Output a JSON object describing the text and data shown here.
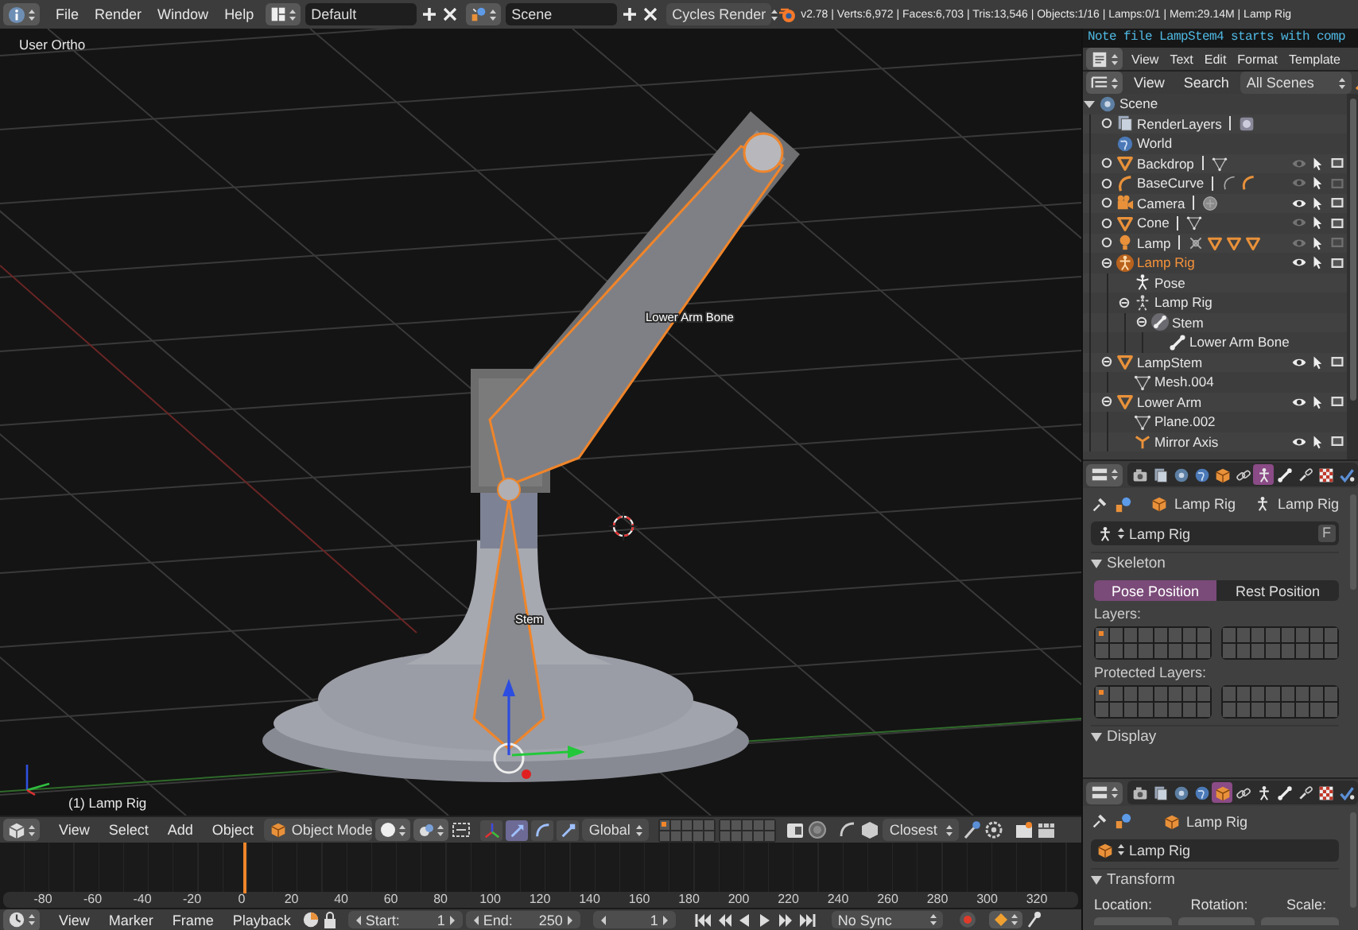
{
  "info_header": {
    "menus": [
      "File",
      "Render",
      "Window",
      "Help"
    ],
    "layout": "Default",
    "scene": "Scene",
    "render_engine": "Cycles Render",
    "stats": "v2.78 | Verts:6,972 | Faces:6,703 | Tris:13,546 | Objects:1/16 | Lamps:0/1 | Mem:29.14M | Lamp Rig"
  },
  "viewport": {
    "view_name": "User Ortho",
    "bone_labels": [
      "Lower Arm Bone",
      "Stem"
    ],
    "object_info": "(1) Lamp Rig"
  },
  "view3d_header": {
    "menus": [
      "View",
      "Select",
      "Add",
      "Object"
    ],
    "mode": "Object Mode",
    "manipulators": [
      {
        "kind": "axes",
        "selected": false
      },
      {
        "kind": "translate",
        "selected": true
      },
      {
        "kind": "rotate",
        "selected": false
      },
      {
        "kind": "scale",
        "selected": false
      }
    ],
    "orientation": "Global",
    "scene_layers": [
      true,
      false,
      false,
      false,
      false,
      false,
      false,
      false,
      false,
      false,
      false,
      false,
      false,
      false,
      false,
      false,
      false,
      false,
      false,
      false
    ],
    "snap_element": "Closest"
  },
  "timeline": {
    "ruler": [
      "-80",
      "-60",
      "-40",
      "-20",
      "0",
      "20",
      "40",
      "60",
      "80",
      "100",
      "120",
      "140",
      "160",
      "180",
      "200",
      "220",
      "240",
      "260",
      "280",
      "300",
      "320"
    ]
  },
  "timeline_header": {
    "menus": [
      "View",
      "Marker",
      "Frame",
      "Playback"
    ],
    "start_label": "Start:",
    "start": "1",
    "end_label": "End:",
    "end": "250",
    "current": "1",
    "sync": "No Sync"
  },
  "text_editor": {
    "line": "Note file LampStem4 starts with comp",
    "menus": [
      "View",
      "Text",
      "Edit",
      "Format",
      "Template"
    ]
  },
  "outliner": {
    "menus": [
      "View",
      "Search"
    ],
    "display_mode": "All Scenes",
    "tree": [
      {
        "label": "Scene",
        "kind": "scene",
        "selected": false,
        "expanded": true,
        "children": [
          {
            "label": "RenderLayers",
            "kind": "render_layers",
            "selected": false,
            "expanded": false,
            "extras": [
              {
                "kind": "render_layer"
              }
            ]
          },
          {
            "label": "World",
            "kind": "world",
            "selected": false
          },
          {
            "label": "Backdrop",
            "kind": "mesh_object",
            "selected": false,
            "expanded": false,
            "visible": false,
            "renderable": true,
            "extras": [
              {
                "kind": "mesh_data"
              }
            ]
          },
          {
            "label": "BaseCurve",
            "kind": "curve_object",
            "selected": false,
            "expanded": false,
            "visible": false,
            "renderable": false,
            "extras": [
              {
                "kind": "curve_data"
              },
              {
                "kind": "curve_object"
              }
            ]
          },
          {
            "label": "Camera",
            "kind": "camera_object",
            "selected": false,
            "expanded": false,
            "visible": true,
            "renderable": true,
            "extras": [
              {
                "kind": "camera_data"
              }
            ]
          },
          {
            "label": "Cone",
            "kind": "mesh_object",
            "selected": false,
            "expanded": false,
            "visible": false,
            "renderable": true,
            "extras": [
              {
                "kind": "mesh_data"
              }
            ]
          },
          {
            "label": "Lamp",
            "kind": "lamp_object",
            "selected": false,
            "expanded": false,
            "visible": false,
            "renderable": false,
            "extras": [
              {
                "kind": "lamp_data"
              },
              {
                "kind": "mesh_object"
              },
              {
                "kind": "mesh_object"
              },
              {
                "kind": "mesh_object"
              }
            ]
          },
          {
            "label": "Lamp Rig",
            "kind": "armature_object",
            "selected": true,
            "expanded": true,
            "visible": true,
            "renderable": true,
            "children": [
              {
                "label": "Pose",
                "kind": "pose",
                "selected": false
              },
              {
                "label": "Lamp Rig",
                "kind": "armature_data",
                "selected": false,
                "expanded": true,
                "children": [
                  {
                    "label": "Stem",
                    "kind": "active_bone",
                    "selected": false,
                    "expanded": true,
                    "children": [
                      {
                        "label": "Lower Arm Bone",
                        "kind": "bone",
                        "selected": false
                      }
                    ]
                  }
                ]
              }
            ]
          },
          {
            "label": "LampStem",
            "kind": "mesh_object",
            "selected": false,
            "expanded": true,
            "visible": true,
            "renderable": true,
            "children": [
              {
                "label": "Mesh.004",
                "kind": "mesh_data",
                "selected": false
              }
            ]
          },
          {
            "label": "Lower Arm",
            "kind": "mesh_object",
            "selected": false,
            "expanded": true,
            "visible": true,
            "renderable": true,
            "children": [
              {
                "label": "Plane.002",
                "kind": "mesh_data",
                "selected": false
              },
              {
                "label": "Mirror Axis",
                "kind": "empty_object",
                "selected": false,
                "visible": true,
                "renderable": true
              }
            ]
          }
        ]
      }
    ]
  },
  "properties": [
    {
      "tabs": [
        {
          "kind": "render",
          "selected": false
        },
        {
          "kind": "render_layers",
          "selected": false
        },
        {
          "kind": "scene",
          "selected": false
        },
        {
          "kind": "world",
          "selected": false
        },
        {
          "kind": "object",
          "selected": false
        },
        {
          "kind": "constraints",
          "selected": false
        },
        {
          "kind": "armature",
          "selected": true
        },
        {
          "kind": "bone",
          "selected": false
        },
        {
          "kind": "bone_constraints",
          "selected": false
        },
        {
          "kind": "texture",
          "selected": false
        },
        {
          "kind": "physics",
          "selected": false
        }
      ],
      "breadcrumb": [
        {
          "kind": "object",
          "label": "Lamp Rig"
        },
        {
          "kind": "armature",
          "label": "Lamp Rig"
        }
      ],
      "datablock": {
        "kind": "armature",
        "name": "Lamp Rig",
        "fake_user": "F"
      },
      "panels": [
        {
          "kind": "skeleton",
          "title": "Skeleton",
          "expanded": true,
          "positions": [
            {
              "label": "Pose Position",
              "selected": true
            },
            {
              "label": "Rest Position",
              "selected": false
            }
          ],
          "layers_label": "Layers:",
          "layers": [
            true,
            false,
            false,
            false,
            false,
            false,
            false,
            false,
            false,
            false,
            false,
            false,
            false,
            false,
            false,
            false,
            false,
            false,
            false,
            false,
            false,
            false,
            false,
            false,
            false,
            false,
            false,
            false,
            false,
            false,
            false,
            false
          ],
          "protected_label": "Protected Layers:",
          "protected_layers": [
            true,
            false,
            false,
            false,
            false,
            false,
            false,
            false,
            false,
            false,
            false,
            false,
            false,
            false,
            false,
            false,
            false,
            false,
            false,
            false,
            false,
            false,
            false,
            false,
            false,
            false,
            false,
            false,
            false,
            false,
            false,
            false
          ]
        },
        {
          "kind": "plain",
          "title": "Display",
          "expanded": true
        }
      ]
    },
    {
      "tabs": [
        {
          "kind": "render",
          "selected": false
        },
        {
          "kind": "render_layers",
          "selected": false
        },
        {
          "kind": "scene",
          "selected": false
        },
        {
          "kind": "world",
          "selected": false
        },
        {
          "kind": "object",
          "selected": true
        },
        {
          "kind": "constraints",
          "selected": false
        },
        {
          "kind": "armature",
          "selected": false
        },
        {
          "kind": "bone",
          "selected": false
        },
        {
          "kind": "bone_constraints",
          "selected": false
        },
        {
          "kind": "texture",
          "selected": false
        },
        {
          "kind": "physics",
          "selected": false
        }
      ],
      "breadcrumb": [
        {
          "kind": "object",
          "label": "Lamp Rig"
        }
      ],
      "datablock": {
        "kind": "object",
        "name": "Lamp Rig"
      },
      "panels": [
        {
          "kind": "transform",
          "title": "Transform",
          "expanded": true,
          "columns": [
            "Location:",
            "Rotation:",
            "Scale:"
          ]
        }
      ]
    }
  ]
}
